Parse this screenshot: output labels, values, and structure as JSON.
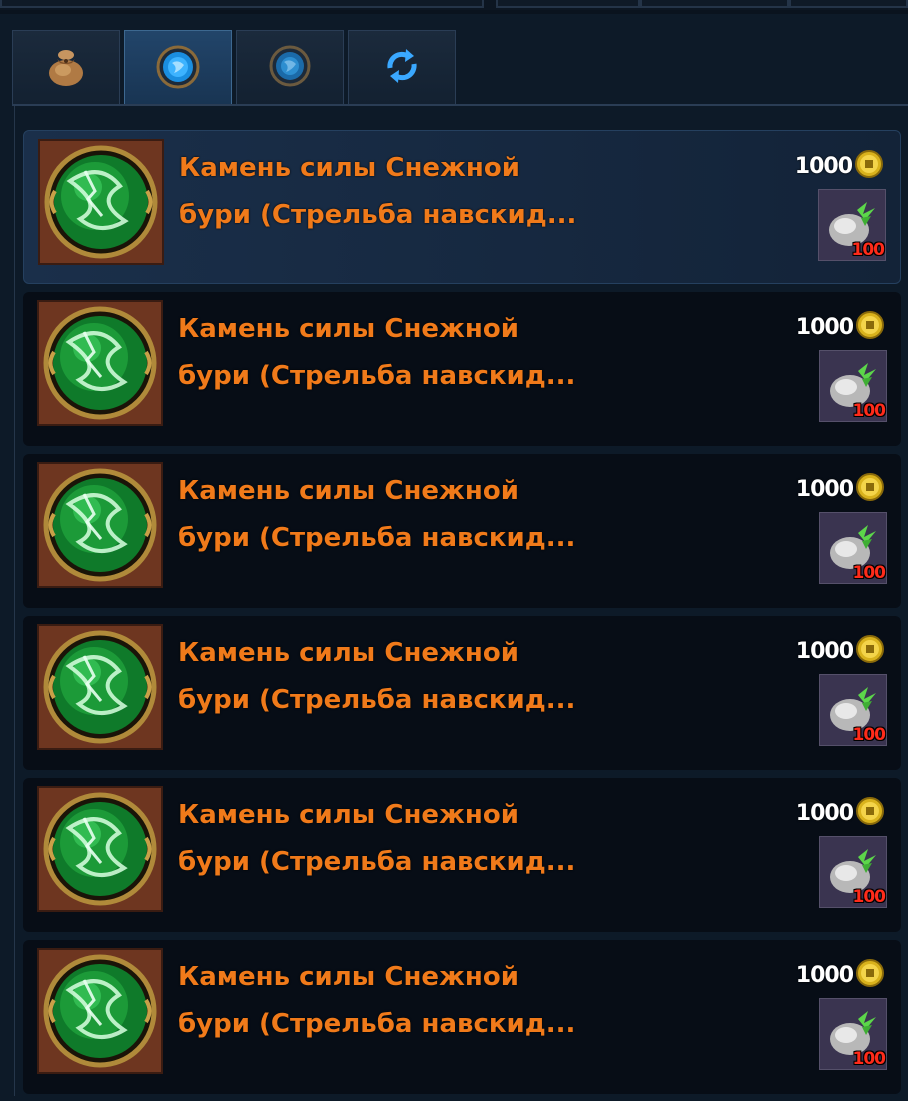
{
  "tabs": [
    {
      "icon": "bag-icon",
      "active": false
    },
    {
      "icon": "blue-gem-icon",
      "active": true
    },
    {
      "icon": "blue-gem-dim-icon",
      "active": false
    },
    {
      "icon": "refresh-icon",
      "active": false
    }
  ],
  "items": [
    {
      "name_line1": "Камень силы Снежной",
      "name_line2": "бури (Стрельба навскид...",
      "price": "1000",
      "stone_count": "100",
      "selected": true
    },
    {
      "name_line1": "Камень силы Снежной",
      "name_line2": "бури (Стрельба навскид...",
      "price": "1000",
      "stone_count": "100",
      "selected": false
    },
    {
      "name_line1": "Камень силы Снежной",
      "name_line2": "бури (Стрельба навскид...",
      "price": "1000",
      "stone_count": "100",
      "selected": false
    },
    {
      "name_line1": "Камень силы Снежной",
      "name_line2": "бури (Стрельба навскид...",
      "price": "1000",
      "stone_count": "100",
      "selected": false
    },
    {
      "name_line1": "Камень силы Снежной",
      "name_line2": "бури (Стрельба навскид...",
      "price": "1000",
      "stone_count": "100",
      "selected": false
    },
    {
      "name_line1": "Камень силы Снежной",
      "name_line2": "бури (Стрельба навскид...",
      "price": "1000",
      "stone_count": "100",
      "selected": false
    }
  ],
  "colors": {
    "item_name": "#f07a1a",
    "stone_count": "#ff2b1a",
    "coin": "#d9b21c",
    "panel_bg": "#0d1a28"
  }
}
